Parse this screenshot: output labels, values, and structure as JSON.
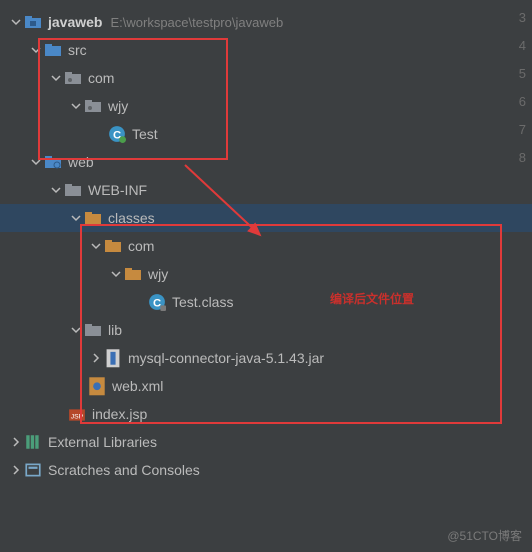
{
  "gutter": [
    "3",
    "4",
    "5",
    "6",
    "7",
    "8"
  ],
  "watermark": "@51CTO博客",
  "annotation": "编译后文件位置",
  "tree": {
    "root": {
      "name": "javaweb",
      "path": "E:\\workspace\\testpro\\javaweb"
    },
    "src": {
      "name": "src"
    },
    "com1": {
      "name": "com"
    },
    "wjy1": {
      "name": "wjy"
    },
    "test_java": {
      "name": "Test"
    },
    "web": {
      "name": "web"
    },
    "webinf": {
      "name": "WEB-INF"
    },
    "classes": {
      "name": "classes"
    },
    "com2": {
      "name": "com"
    },
    "wjy2": {
      "name": "wjy"
    },
    "test_class": {
      "name": "Test.class"
    },
    "lib": {
      "name": "lib"
    },
    "mysql_jar": {
      "name": "mysql-connector-java-5.1.43.jar"
    },
    "webxml": {
      "name": "web.xml"
    },
    "indexjsp": {
      "name": "index.jsp"
    },
    "ext_lib": {
      "name": "External Libraries"
    },
    "scratches": {
      "name": "Scratches and Consoles"
    }
  },
  "colors": {
    "folder_blue": "#4a88c7",
    "folder_gray": "#8a8f96",
    "folder_orange": "#c68a3f",
    "class_icon": "#3a93c4",
    "jar_fill": "#3a6fb5",
    "xml_fill": "#c68a3f",
    "jsp_fill": "#b5482a"
  }
}
